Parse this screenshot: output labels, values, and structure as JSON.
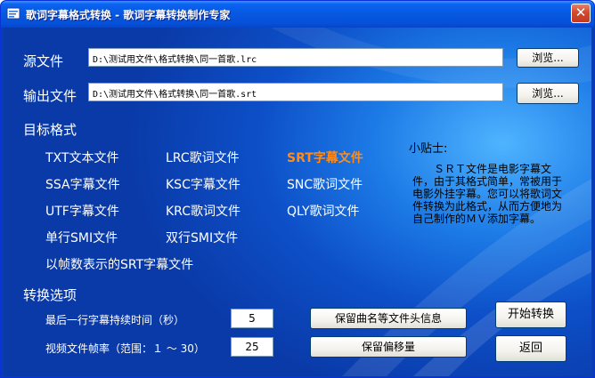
{
  "window": {
    "title": "歌词字幕格式转换 - 歌词字幕转换制作专家",
    "close_glyph": "✕"
  },
  "source": {
    "label": "源文件",
    "value": "D:\\测试用文件\\格式转换\\同一首歌.lrc",
    "browse_label": "浏览..."
  },
  "output": {
    "label": "输出文件",
    "value": "D:\\测试用文件\\格式转换\\同一首歌.srt",
    "browse_label": "浏览..."
  },
  "target_format": {
    "heading": "目标格式",
    "options": [
      "TXT文本文件",
      "LRC歌词文件",
      "SRT字幕文件",
      "SSA字幕文件",
      "KSC字幕文件",
      "SNC歌词文件",
      "UTF字幕文件",
      "KRC歌词文件",
      "QLY歌词文件",
      "单行SMI文件",
      "双行SMI文件",
      "以帧数表示的SRT字幕文件"
    ],
    "selected": "SRT字幕文件"
  },
  "tip": {
    "title": "小贴士:",
    "body": "　　ＳＲＴ文件是电影字幕文件，由于其格式简单，常被用于电影外挂字幕。您可以将歌词文件转换为此格式，从而方便地为自己制作的ＭＶ添加字幕。"
  },
  "options": {
    "heading": "转换选项",
    "last_line_label": "最后一行字幕持续时间（秒）",
    "last_line_value": "5",
    "fps_label": "视频文件帧率（范围：１ ～ 30）",
    "fps_value": "25",
    "keep_header_label": "保留曲名等文件头信息",
    "keep_offset_label": "保留偏移量"
  },
  "actions": {
    "start_label": "开始转换",
    "back_label": "返回"
  },
  "colors": {
    "selected_format": "#ff8c1a",
    "titlebar": "#0758e0",
    "background": "#0d4fc8"
  }
}
